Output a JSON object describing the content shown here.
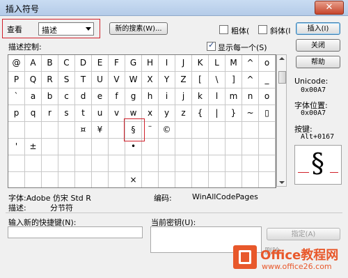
{
  "window": {
    "title": "插入符号",
    "close": "✕"
  },
  "view": {
    "label": "查看",
    "selected": "描述",
    "new_search_label": "新的搜素(W)..."
  },
  "options": {
    "bold_label": "粗体(",
    "italic_label": "斜体(I",
    "show_each_label": "显示每一个(S)",
    "show_each_checked": true,
    "bold_checked": false,
    "italic_checked": false
  },
  "describe_control_label": "描述控制:",
  "grid": {
    "rows": [
      [
        "@",
        "A",
        "B",
        "C",
        "D",
        "E",
        "F",
        "G",
        "H",
        "I",
        "J",
        "K",
        "L",
        "M",
        "^",
        "o"
      ],
      [
        "P",
        "Q",
        "R",
        "S",
        "T",
        "U",
        "V",
        "W",
        "X",
        "Y",
        "Z",
        "[",
        "\\",
        "]",
        "^",
        "_"
      ],
      [
        "`",
        "a",
        "b",
        "c",
        "d",
        "e",
        "f",
        "g",
        "h",
        "i",
        "j",
        "k",
        "l",
        "m",
        "n",
        "o"
      ],
      [
        "p",
        "q",
        "r",
        "s",
        "t",
        "u",
        "v",
        "w",
        "x",
        "y",
        "z",
        "{",
        "|",
        "}",
        "~",
        "▯"
      ],
      [
        "",
        "",
        "",
        "",
        "¤",
        "¥",
        "",
        "§",
        "¨",
        "©",
        "",
        "",
        "",
        "",
        "",
        ""
      ],
      [
        "'",
        "±",
        "",
        "",
        "",
        "",
        "",
        "•",
        "",
        "",
        "",
        "",
        "",
        "",
        "",
        ""
      ],
      [
        "",
        "",
        "",
        "",
        "",
        "",
        "",
        "",
        "",
        "",
        "",
        "",
        "",
        "",
        "",
        ""
      ],
      [
        "",
        "",
        "",
        "",
        "",
        "",
        "",
        "×",
        "",
        "",
        "",
        "",
        "",
        "",
        "",
        ""
      ]
    ],
    "selected_symbol": "§"
  },
  "buttons": {
    "insert": "插入(I)",
    "close": "关闭",
    "help": "帮助",
    "assign": "指定(A)"
  },
  "unicode": {
    "label": "Unicode:",
    "value": "0x00A7"
  },
  "font_position": {
    "label": "字体位置:",
    "value": "0x00A7"
  },
  "keystroke": {
    "label": "按键:",
    "value": "Alt+0167"
  },
  "preview_symbol": "§",
  "font_info": {
    "label": "字体:Adobe 仿宋 Std R",
    "encoding_label": "编码:",
    "encoding_value": "WinAllCodePages"
  },
  "description": {
    "label": "描述:",
    "value": "分节符"
  },
  "shortcut": {
    "new_label": "输入新的快捷键(N):",
    "current_label": "当前密钥(U):",
    "new_value": ""
  },
  "watermark": {
    "name": "Office教程网",
    "url": "www.office26.com",
    "remove_text": "删除"
  },
  "colors": {
    "highlight_red": "#d0202a",
    "brand_orange": "#e8582b"
  }
}
